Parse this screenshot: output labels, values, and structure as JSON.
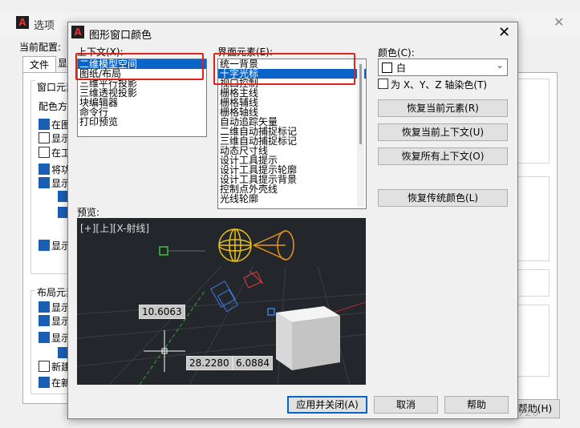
{
  "background_window": {
    "title": "选项",
    "profile_label": "当前配置:",
    "tab_file": "文件",
    "tab_second_partial": "显",
    "group1_title": "窗口元素",
    "group1_subtitle": "配色方",
    "checks": [
      {
        "label": "在图",
        "checked": true
      },
      {
        "label": "显示",
        "checked": false
      },
      {
        "label": "在工",
        "checked": false
      },
      {
        "label": "将功",
        "checked": true
      },
      {
        "label": "显示",
        "checked": true
      },
      {
        "label": "",
        "checked": true
      },
      {
        "label": "",
        "checked": true
      },
      {
        "label": "显示",
        "checked": true
      }
    ],
    "group2_title": "布局元素",
    "checks2": [
      {
        "label": "显示",
        "checked": true
      },
      {
        "label": "显示",
        "checked": true
      },
      {
        "label": "显示",
        "checked": true
      },
      {
        "label": "",
        "checked": true
      },
      {
        "label": "新建",
        "checked": false
      },
      {
        "label": "在新",
        "checked": true
      }
    ],
    "help_button": "帮助(H)",
    "watermark": "CSDN @小虾米0720"
  },
  "dialog": {
    "title": "图形窗口颜色",
    "context_label": "上下文(X):",
    "context_items": [
      {
        "label": "二维模型空间",
        "selected": true
      },
      {
        "label": "图纸/布局",
        "selected": false
      },
      {
        "label": "三维平行投影",
        "selected": false
      },
      {
        "label": "三维透视投影",
        "selected": false
      },
      {
        "label": "块编辑器",
        "selected": false
      },
      {
        "label": "命令行",
        "selected": false
      },
      {
        "label": "打印预览",
        "selected": false
      }
    ],
    "element_label": "界面元素(E):",
    "element_items": [
      {
        "label": "统一背景",
        "selected": false
      },
      {
        "label": "十字光标",
        "selected": true
      },
      {
        "label": "视口控制",
        "selected": false
      },
      {
        "label": "栅格主线",
        "selected": false
      },
      {
        "label": "栅格辅线",
        "selected": false
      },
      {
        "label": "栅格轴线",
        "selected": false
      },
      {
        "label": "自动追踪矢量",
        "selected": false
      },
      {
        "label": "二维自动捕捉标记",
        "selected": false
      },
      {
        "label": "三维自动捕捉标记",
        "selected": false
      },
      {
        "label": "动态尺寸线",
        "selected": false
      },
      {
        "label": "设计工具提示",
        "selected": false
      },
      {
        "label": "设计工具提示轮廓",
        "selected": false
      },
      {
        "label": "设计工具提示背景",
        "selected": false
      },
      {
        "label": "控制点外壳线",
        "selected": false
      },
      {
        "label": "光线轮廓",
        "selected": false
      }
    ],
    "color_label": "颜色(C):",
    "color_value": "白",
    "color_swatch": "#ffffff",
    "tint_checkbox_label": "为 X、Y、Z 轴染色(T)",
    "tint_checked": false,
    "btn_restore_element": "恢复当前元素(R)",
    "btn_restore_context": "恢复当前上下文(U)",
    "btn_restore_all": "恢复所有上下文(O)",
    "btn_restore_classic": "恢复传统颜色(L)",
    "preview_label": "预览:",
    "preview": {
      "viewport_caption": "[+][上][X-射线]",
      "readout_1": "10.6063",
      "readout_2": "28.2280",
      "readout_3": "6.0884"
    },
    "btn_apply_close": "应用并关闭(A)",
    "btn_cancel": "取消",
    "btn_help": "帮助"
  },
  "colors": {
    "selection_blue": "#0a64c8",
    "highlight_red": "#e0221c",
    "preview_bg": "#23262b"
  }
}
